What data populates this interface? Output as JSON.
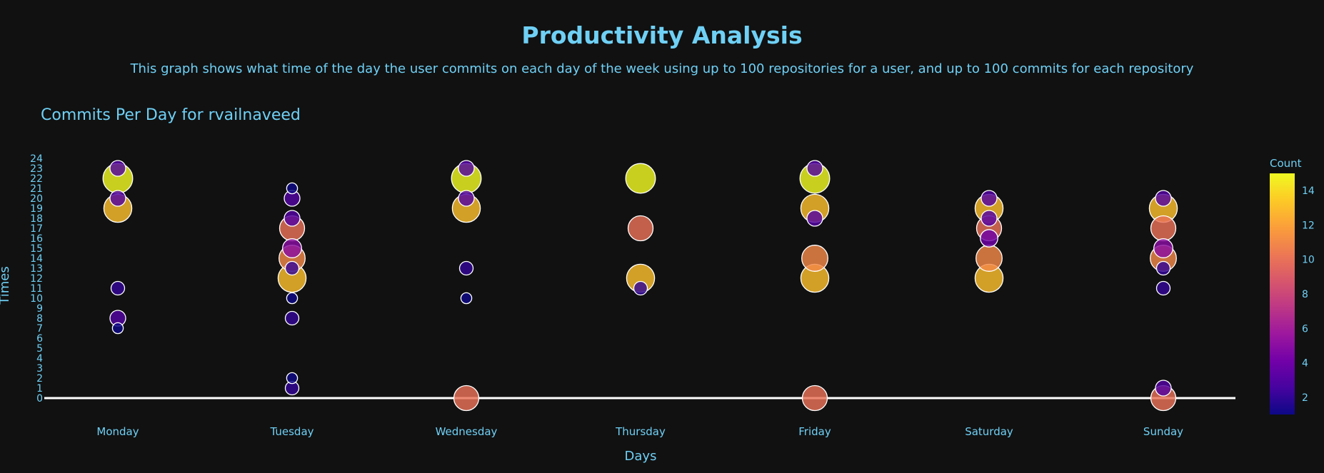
{
  "page": {
    "title": "Productivity Analysis",
    "subtitle": "This graph shows what time of the day the user commits on each day of the week using up to 100 repositories for a user, and up to 100 commits for each repository"
  },
  "chart_data": {
    "type": "scatter",
    "title": "Commits Per Day for rvailnaveed",
    "xlabel": "Days",
    "ylabel": "Times",
    "categories": [
      "Monday",
      "Tuesday",
      "Wednesday",
      "Thursday",
      "Friday",
      "Saturday",
      "Sunday"
    ],
    "yticks": [
      0,
      1,
      2,
      3,
      4,
      5,
      6,
      7,
      8,
      9,
      10,
      11,
      12,
      13,
      14,
      15,
      16,
      17,
      18,
      19,
      20,
      21,
      22,
      23,
      24
    ],
    "ylim": [
      0,
      24
    ],
    "grid": false,
    "marker_size_and_color": "Count",
    "colorbar": {
      "title": "Count",
      "ticks": [
        2,
        4,
        6,
        8,
        10,
        12,
        14
      ],
      "range": [
        1,
        15
      ]
    },
    "colorscale": [
      "#0d0887",
      "#46039f",
      "#7201a8",
      "#9c179e",
      "#bd3786",
      "#d8576b",
      "#ed7953",
      "#fb9f3a",
      "#fdca26",
      "#f0f921"
    ],
    "points": [
      {
        "day": "Monday",
        "hour": 7,
        "count": 1
      },
      {
        "day": "Monday",
        "hour": 8,
        "count": 3
      },
      {
        "day": "Monday",
        "hour": 11,
        "count": 2
      },
      {
        "day": "Monday",
        "hour": 19,
        "count": 13
      },
      {
        "day": "Monday",
        "hour": 20,
        "count": 3
      },
      {
        "day": "Monday",
        "hour": 22,
        "count": 15
      },
      {
        "day": "Monday",
        "hour": 23,
        "count": 3
      },
      {
        "day": "Tuesday",
        "hour": 1,
        "count": 2
      },
      {
        "day": "Tuesday",
        "hour": 2,
        "count": 1
      },
      {
        "day": "Tuesday",
        "hour": 8,
        "count": 2
      },
      {
        "day": "Tuesday",
        "hour": 10,
        "count": 1
      },
      {
        "day": "Tuesday",
        "hour": 12,
        "count": 13
      },
      {
        "day": "Tuesday",
        "hour": 13,
        "count": 2
      },
      {
        "day": "Tuesday",
        "hour": 14,
        "count": 11
      },
      {
        "day": "Tuesday",
        "hour": 15,
        "count": 5
      },
      {
        "day": "Tuesday",
        "hour": 17,
        "count": 10
      },
      {
        "day": "Tuesday",
        "hour": 18,
        "count": 3
      },
      {
        "day": "Tuesday",
        "hour": 20,
        "count": 3
      },
      {
        "day": "Tuesday",
        "hour": 21,
        "count": 1
      },
      {
        "day": "Wednesday",
        "hour": 0,
        "count": 10
      },
      {
        "day": "Wednesday",
        "hour": 10,
        "count": 1
      },
      {
        "day": "Wednesday",
        "hour": 13,
        "count": 2
      },
      {
        "day": "Wednesday",
        "hour": 19,
        "count": 13
      },
      {
        "day": "Wednesday",
        "hour": 20,
        "count": 3
      },
      {
        "day": "Wednesday",
        "hour": 22,
        "count": 15
      },
      {
        "day": "Wednesday",
        "hour": 23,
        "count": 3
      },
      {
        "day": "Thursday",
        "hour": 11,
        "count": 2
      },
      {
        "day": "Thursday",
        "hour": 12,
        "count": 13
      },
      {
        "day": "Thursday",
        "hour": 17,
        "count": 10
      },
      {
        "day": "Thursday",
        "hour": 22,
        "count": 15
      },
      {
        "day": "Friday",
        "hour": 0,
        "count": 10
      },
      {
        "day": "Friday",
        "hour": 12,
        "count": 13
      },
      {
        "day": "Friday",
        "hour": 14,
        "count": 11
      },
      {
        "day": "Friday",
        "hour": 18,
        "count": 3
      },
      {
        "day": "Friday",
        "hour": 19,
        "count": 13
      },
      {
        "day": "Friday",
        "hour": 22,
        "count": 15
      },
      {
        "day": "Friday",
        "hour": 23,
        "count": 3
      },
      {
        "day": "Saturday",
        "hour": 12,
        "count": 13
      },
      {
        "day": "Saturday",
        "hour": 14,
        "count": 11
      },
      {
        "day": "Saturday",
        "hour": 16,
        "count": 4
      },
      {
        "day": "Saturday",
        "hour": 17,
        "count": 10
      },
      {
        "day": "Saturday",
        "hour": 18,
        "count": 3
      },
      {
        "day": "Saturday",
        "hour": 19,
        "count": 13
      },
      {
        "day": "Saturday",
        "hour": 20,
        "count": 3
      },
      {
        "day": "Sunday",
        "hour": 0,
        "count": 10
      },
      {
        "day": "Sunday",
        "hour": 1,
        "count": 3
      },
      {
        "day": "Sunday",
        "hour": 11,
        "count": 2
      },
      {
        "day": "Sunday",
        "hour": 13,
        "count": 2
      },
      {
        "day": "Sunday",
        "hour": 14,
        "count": 11
      },
      {
        "day": "Sunday",
        "hour": 15,
        "count": 5
      },
      {
        "day": "Sunday",
        "hour": 17,
        "count": 10
      },
      {
        "day": "Sunday",
        "hour": 19,
        "count": 13
      },
      {
        "day": "Sunday",
        "hour": 20,
        "count": 3
      }
    ]
  }
}
